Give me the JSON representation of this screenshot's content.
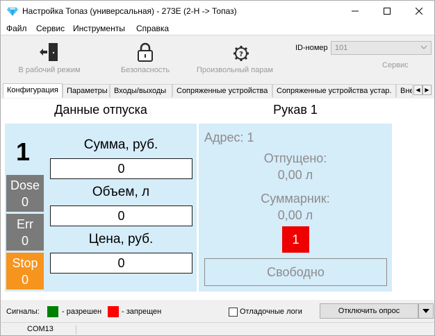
{
  "window": {
    "title": "Настройка Топаз (универсальная) - 273E (2-Н -> Топаз)",
    "icon": "diamond-icon"
  },
  "menu": [
    "Файл",
    "Сервис",
    "Инструменты",
    "Справка"
  ],
  "toolbar": {
    "work_mode": "В рабочий режим",
    "security": "Безопасность",
    "custom_param": "Произвольный парам",
    "id_label": "ID-номер",
    "id_value": "101",
    "service": "Сервис"
  },
  "tabs": [
    "Конфигурация",
    "Параметры",
    "Входы/выходы",
    "Сопряженные устройства",
    "Сопряженные устройства устар.",
    "Вне"
  ],
  "left_panel": {
    "title": "Данные отпуска",
    "number": "1",
    "states": [
      {
        "label": "Dose",
        "value": "0",
        "color": "#7a7a7a"
      },
      {
        "label": "Err",
        "value": "0",
        "color": "#7a7a7a"
      },
      {
        "label": "Stop",
        "value": "0",
        "color": "#f7941d"
      }
    ],
    "fields": [
      {
        "label": "Сумма, руб.",
        "value": "0"
      },
      {
        "label": "Объем, л",
        "value": "0"
      },
      {
        "label": "Цена, руб.",
        "value": "0"
      }
    ]
  },
  "right_panel": {
    "title": "Рукав 1",
    "address": "Адрес: 1",
    "dispensed_label": "Отпущено:",
    "dispensed_value": "0,00 л",
    "total_label": "Суммарник:",
    "total_value": "0,00 л",
    "indicator": "1",
    "status": "Свободно"
  },
  "signals": {
    "label": "Сигналы:",
    "allowed": "- разрешен",
    "allowed_color": "#008000",
    "forbidden": "- запрещен",
    "forbidden_color": "#ff0000",
    "debug_logs": "Отладочные логи",
    "disconnect": "Отключить опрос"
  },
  "statusbar": {
    "port": "COM13"
  }
}
